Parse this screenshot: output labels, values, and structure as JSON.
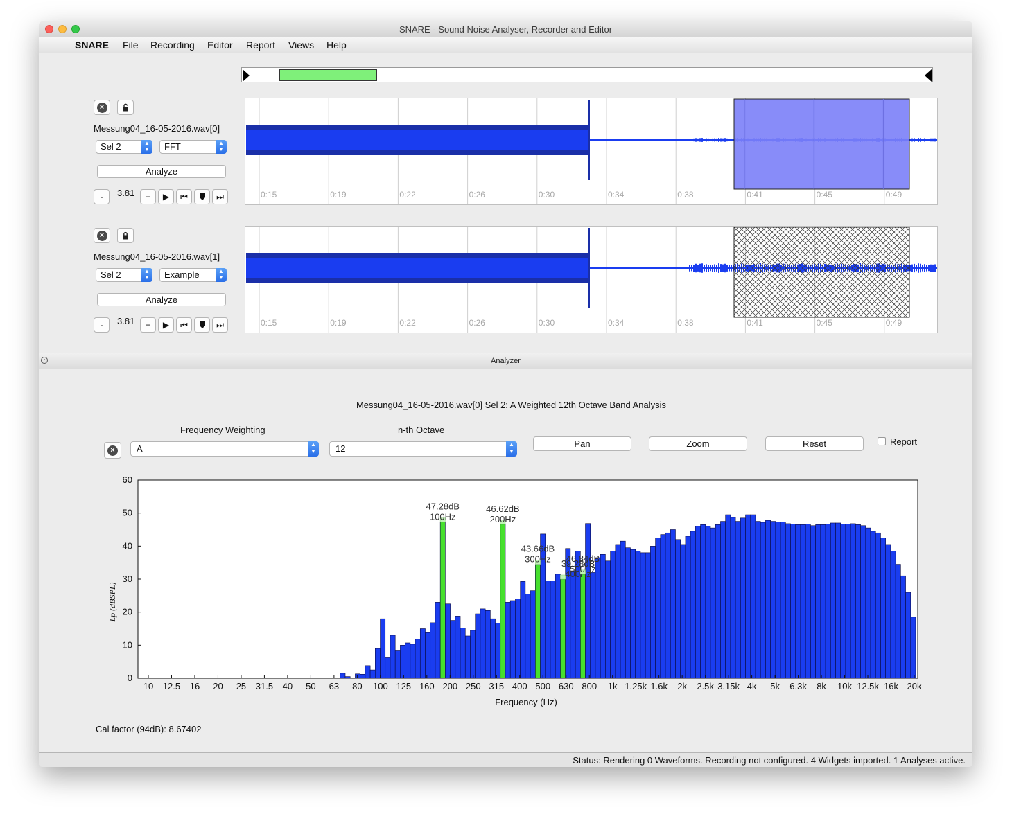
{
  "window": {
    "title": "SNARE - Sound Noise Analyser, Recorder and Editor"
  },
  "menu": {
    "app": "SNARE",
    "items": [
      "File",
      "Recording",
      "Editor",
      "Report",
      "Views",
      "Help"
    ]
  },
  "tracks": [
    {
      "filename": "Messung04_16-05-2016.wav[0]",
      "selection": "Sel 2",
      "analysis": "FFT",
      "analyze_label": "Analyze",
      "zoom": "3.81",
      "lock_state": "unlocked",
      "selection_style": "filled",
      "time_ticks": [
        "0:15",
        "0:19",
        "0:22",
        "0:26",
        "0:30",
        "0:34",
        "0:38",
        "0:41",
        "0:45",
        "0:49"
      ]
    },
    {
      "filename": "Messung04_16-05-2016.wav[1]",
      "selection": "Sel 2",
      "analysis": "Example",
      "analyze_label": "Analyze",
      "zoom": "3.81",
      "lock_state": "locked",
      "selection_style": "hatched",
      "time_ticks": [
        "0:15",
        "0:19",
        "0:22",
        "0:26",
        "0:30",
        "0:34",
        "0:38",
        "0:41",
        "0:45",
        "0:49"
      ]
    }
  ],
  "transport": {
    "minus": "-",
    "plus": "+"
  },
  "analyzer": {
    "panel_title": "Analyzer",
    "analysis_title": "Messung04_16-05-2016.wav[0] Sel 2: A Weighted 12th Octave Band Analysis",
    "freq_weighting_label": "Frequency Weighting",
    "freq_weighting_value": "A",
    "octave_label": "n-th Octave",
    "octave_value": "12",
    "pan_label": "Pan",
    "zoom_label": "Zoom",
    "reset_label": "Reset",
    "report_label": "Report",
    "cal_factor": "Cal factor (94dB): 8.67402"
  },
  "status": "Status:  Rendering 0 Waveforms.  Recording not configured.  4 Widgets imported.  1 Analyses active.",
  "colors": {
    "bar": "#1a3df0",
    "highlight": "#46e02d",
    "selection": "#7b80f8",
    "waveform": "#1a3df0"
  },
  "chart_data": {
    "type": "bar",
    "xlabel": "Frequency (Hz)",
    "ylabel": "Lp (dBSPL)",
    "ylim": [
      0,
      60
    ],
    "yticks": [
      0,
      10,
      20,
      30,
      40,
      50,
      60
    ],
    "xtick_labels": [
      "10",
      "12.5",
      "16",
      "20",
      "25",
      "31.5",
      "40",
      "50",
      "63",
      "80",
      "100",
      "125",
      "160",
      "200",
      "250",
      "315",
      "400",
      "500",
      "630",
      "800",
      "1k",
      "1.25k",
      "1.6k",
      "2k",
      "2.5k",
      "3.15k",
      "4k",
      "5k",
      "6.3k",
      "8k",
      "10k",
      "12.5k",
      "16k",
      "20k"
    ],
    "bands_per_octave": 12,
    "values": [
      0,
      0,
      0,
      0,
      0,
      0,
      0,
      0,
      0,
      0,
      0,
      0,
      0,
      0,
      0,
      0,
      0,
      0,
      0,
      0,
      0,
      0,
      0,
      0,
      0,
      0,
      0,
      0,
      0,
      0,
      0,
      0,
      0,
      0,
      0,
      0,
      0,
      0,
      0,
      0,
      1.5,
      0.5,
      0,
      1.3,
      1.2,
      3.8,
      2.5,
      9,
      18,
      6.2,
      13,
      8.5,
      10,
      10.7,
      10.3,
      11.8,
      15,
      13.8,
      16.8,
      23,
      47.28,
      22.5,
      17.5,
      18.8,
      15.2,
      12.8,
      14.5,
      19.5,
      21,
      20.5,
      18,
      16.7,
      46.62,
      23,
      23.5,
      24,
      29.3,
      25.5,
      26.5,
      34.5,
      43.66,
      29.5,
      29.5,
      31.5,
      30,
      39.28,
      32.5,
      38.5,
      31.5,
      46.84,
      32,
      36.5,
      37.5,
      35.5,
      38.5,
      40.5,
      41.5,
      39.5,
      39,
      38.5,
      38,
      38,
      40,
      42.5,
      43.5,
      44,
      45,
      42,
      40.5,
      43,
      44.5,
      46,
      46.5,
      46,
      45.5,
      46.5,
      47.5,
      49.5,
      48.7,
      47.5,
      48.5,
      49.5,
      49.5,
      47.5,
      47.2,
      47.8,
      47.5,
      47.3,
      47.3,
      46.8,
      46.7,
      46.5,
      46.5,
      46.7,
      46.2,
      46.5,
      46.5,
      46.7,
      47,
      47,
      46.7,
      46.7,
      46.8,
      46.5,
      46.2,
      45.5,
      44.5,
      44,
      42.5,
      40.5,
      38.5,
      34.5,
      31,
      26,
      18.5
    ],
    "highlights": [
      {
        "band": 60,
        "value": "47.28dB",
        "freq": "100Hz"
      },
      {
        "band": 72,
        "value": "46.62dB",
        "freq": "200Hz"
      },
      {
        "band": 79,
        "value": "43.66dB",
        "freq": "300Hz"
      },
      {
        "band": 84,
        "value": "39.28dB",
        "freq": "400Hz"
      },
      {
        "band": 88,
        "value": "46.84dB",
        "freq": "500Hz"
      }
    ]
  }
}
